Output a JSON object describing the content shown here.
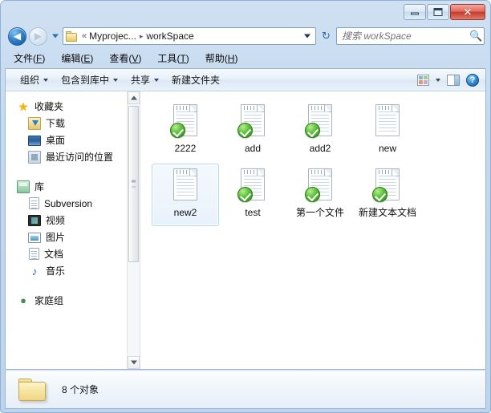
{
  "window": {
    "buttons": {
      "minimize": "minimize-button",
      "maximize": "maximize-button",
      "close_label": "✕"
    }
  },
  "navigation": {
    "back_glyph": "◀",
    "forward_glyph": "▶",
    "refresh_glyph": "↻",
    "address": {
      "chevrons": "«",
      "crumbs": [
        "Myprojec...",
        "workSpace"
      ],
      "separator": "▸"
    }
  },
  "search": {
    "placeholder": "搜索 workSpace",
    "value": "",
    "icon_glyph": "🔍"
  },
  "menubar": {
    "items": [
      {
        "text": "文件",
        "accel": "F"
      },
      {
        "text": "编辑",
        "accel": "E"
      },
      {
        "text": "查看",
        "accel": "V"
      },
      {
        "text": "工具",
        "accel": "T"
      },
      {
        "text": "帮助",
        "accel": "H"
      }
    ]
  },
  "commandbar": {
    "items": [
      {
        "label": "组织",
        "has_caret": true
      },
      {
        "label": "包含到库中",
        "has_caret": true
      },
      {
        "label": "共享",
        "has_caret": true
      },
      {
        "label": "新建文件夹",
        "has_caret": false
      }
    ],
    "view_mode_caret": "▾",
    "help_label": "?"
  },
  "sidebar": {
    "groups": [
      {
        "header": {
          "label": "收藏夹",
          "icon": "star-icon"
        },
        "items": [
          {
            "label": "下载",
            "icon": "downloads-icon"
          },
          {
            "label": "桌面",
            "icon": "desktop-icon"
          },
          {
            "label": "最近访问的位置",
            "icon": "recent-places-icon"
          }
        ]
      },
      {
        "header": {
          "label": "库",
          "icon": "library-icon"
        },
        "items": [
          {
            "label": "Subversion",
            "icon": "document-icon"
          },
          {
            "label": "视频",
            "icon": "video-icon"
          },
          {
            "label": "图片",
            "icon": "pictures-icon"
          },
          {
            "label": "文档",
            "icon": "documents-icon"
          },
          {
            "label": "音乐",
            "icon": "music-icon"
          }
        ]
      },
      {
        "header": {
          "label": "家庭组",
          "icon": "homegroup-icon"
        },
        "items": []
      }
    ]
  },
  "files": [
    {
      "name": "2222",
      "icon": "text-file-icon",
      "svn_overlay": true,
      "selected": false
    },
    {
      "name": "add",
      "icon": "text-file-icon",
      "svn_overlay": true,
      "selected": false
    },
    {
      "name": "add2",
      "icon": "text-file-icon",
      "svn_overlay": true,
      "selected": false
    },
    {
      "name": "new",
      "icon": "text-file-icon",
      "svn_overlay": false,
      "selected": false
    },
    {
      "name": "new2",
      "icon": "text-file-icon",
      "svn_overlay": false,
      "selected": true
    },
    {
      "name": "test",
      "icon": "text-file-icon",
      "svn_overlay": true,
      "selected": false
    },
    {
      "name": "第一个文件",
      "icon": "text-file-icon",
      "svn_overlay": true,
      "selected": false
    },
    {
      "name": "新建文本文档",
      "icon": "text-file-icon",
      "svn_overlay": true,
      "selected": false
    }
  ],
  "statusbar": {
    "text": "8 个对象",
    "icon": "folder-icon"
  },
  "colors": {
    "title_bar": "#c3d8ee",
    "close_button": "#c33b2c",
    "selection_border": "#b8d6ef",
    "svn_green": "#5fc23d",
    "accent_blue": "#2f7fc9"
  }
}
